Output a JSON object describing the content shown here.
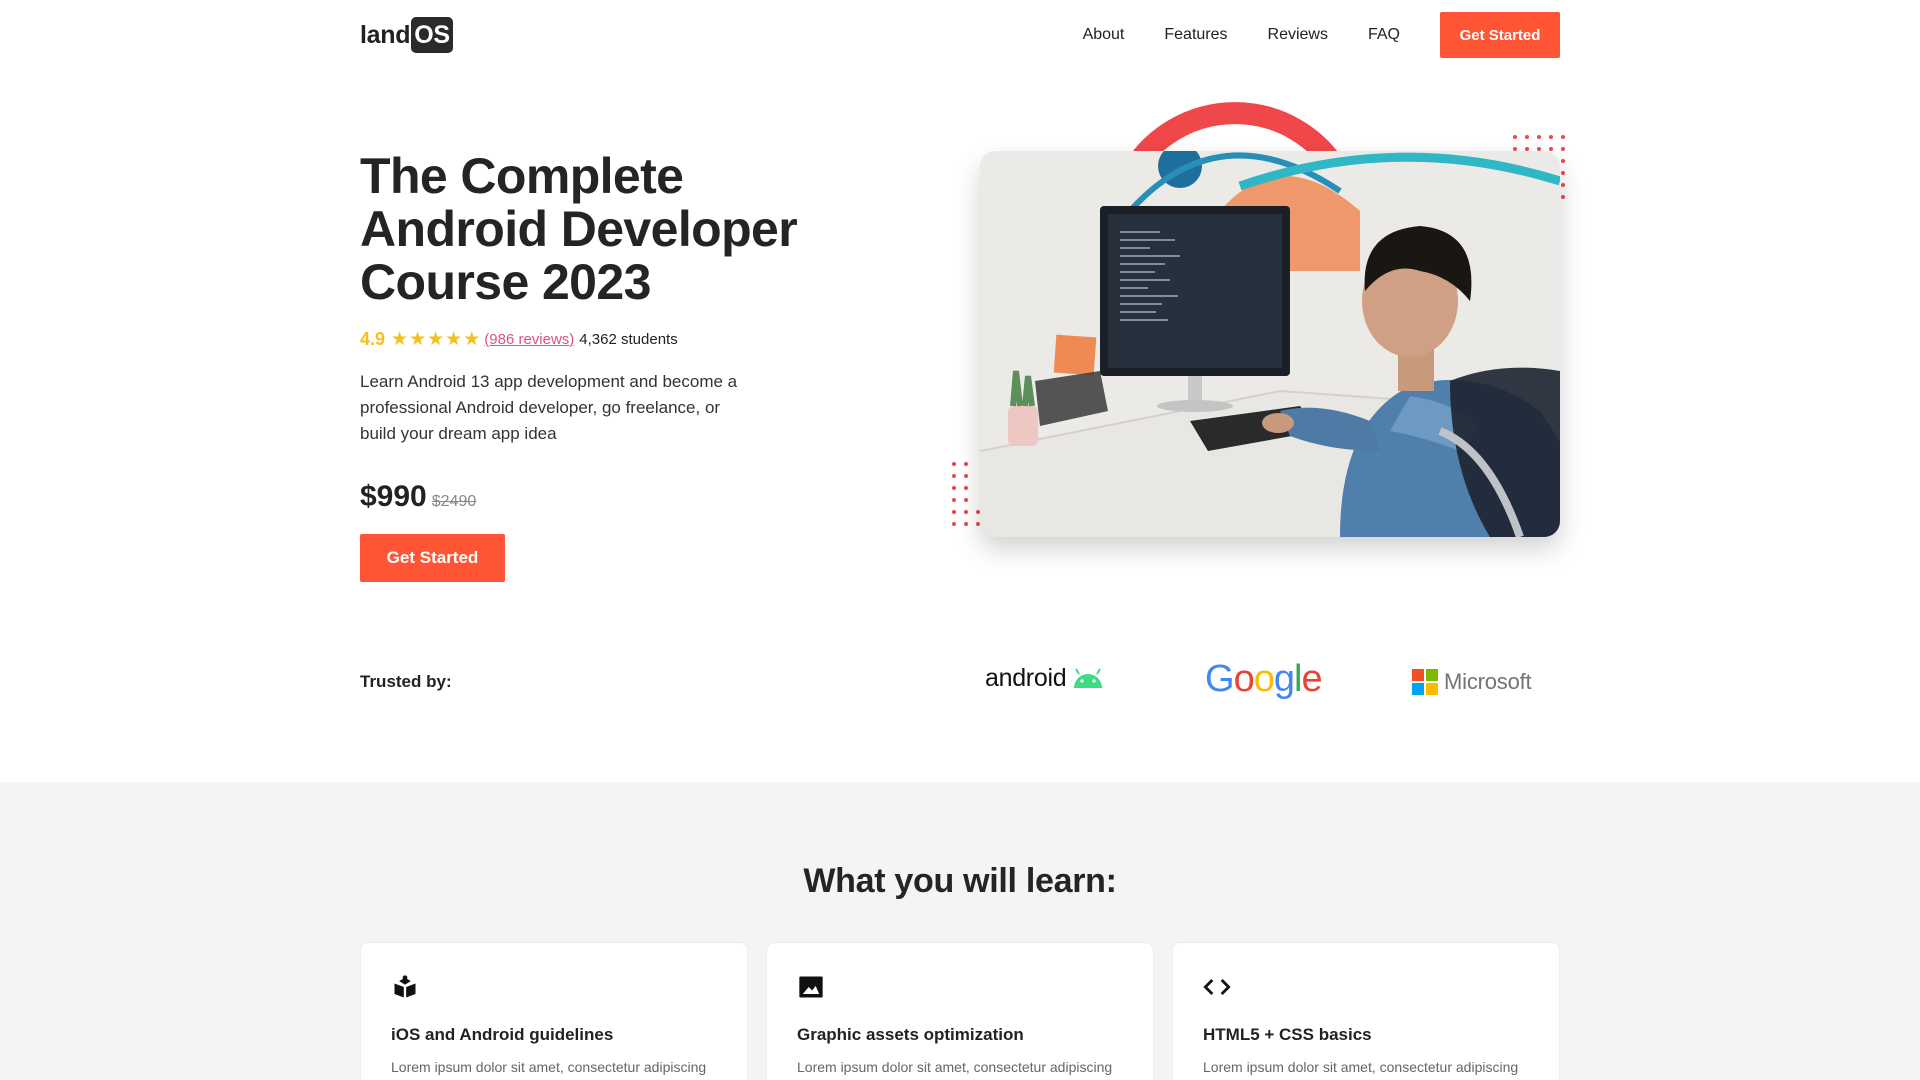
{
  "header": {
    "logo_text": "land",
    "logo_badge": "OS",
    "nav": [
      "About",
      "Features",
      "Reviews",
      "FAQ"
    ],
    "cta_label": "Get Started"
  },
  "hero": {
    "title": "The Complete Android Developer Course 2023",
    "rating": "4.9",
    "stars": 5,
    "reviews": "(986 reviews)",
    "students": "4,362 students",
    "description": "Learn Android 13 app development and become a professional Android developer, go freelance, or build your dream app idea",
    "price": "$990",
    "price_old": "$2490",
    "cta_label": "Get Started",
    "image_icon": "developer-at-computer-photo"
  },
  "trusted": {
    "label": "Trusted by:",
    "logos": [
      {
        "name": "android",
        "text": "android"
      },
      {
        "name": "google",
        "text": "Google"
      },
      {
        "name": "microsoft",
        "text": "Microsoft"
      }
    ]
  },
  "learn": {
    "title": "What you will learn:",
    "cards": [
      {
        "icon": "reader-icon",
        "title": "iOS and Android guidelines",
        "text": "Lorem ipsum dolor sit amet, consectetur adipiscing"
      },
      {
        "icon": "image-icon",
        "title": "Graphic assets optimization",
        "text": "Lorem ipsum dolor sit amet, consectetur adipiscing"
      },
      {
        "icon": "code-icon",
        "title": "HTML5 + CSS basics",
        "text": "Lorem ipsum dolor sit amet, consectetur adipiscing"
      }
    ]
  },
  "colors": {
    "accent": "#ff5534",
    "star": "#f4c01e",
    "link": "#e0527a"
  }
}
